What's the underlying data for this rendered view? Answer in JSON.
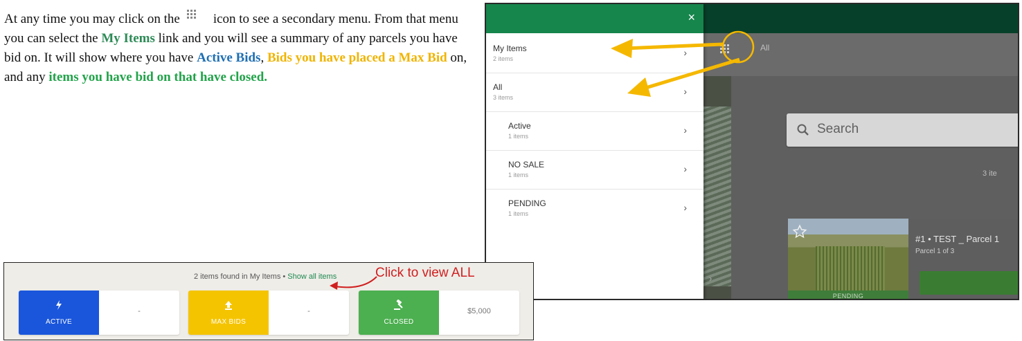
{
  "instruction": {
    "p1": "At any time you may click on the",
    "p2": "icon to see a secondary menu. From that menu you can select the",
    "my_items": "My Items",
    "p3": "link and you will see a summary of any parcels you have bid on. It will show where you have",
    "active_bids": "Active Bids",
    "comma": ",",
    "max_bid": "Bids you have placed a Max Bid",
    "p4": "on, and any",
    "closed": "items you have bid on that have closed."
  },
  "drawer": {
    "close_glyph": "×",
    "items": [
      {
        "label": "My Items",
        "count": "2 items"
      },
      {
        "label": "All",
        "count": "3 items"
      },
      {
        "label": "Active",
        "count": "1 items"
      },
      {
        "label": "NO SALE",
        "count": "1 items"
      },
      {
        "label": "PENDING",
        "count": "1 items"
      }
    ]
  },
  "screen": {
    "breadcrumb": "All",
    "search_placeholder": "Search",
    "count_truncated": "3 ite",
    "card": {
      "title": "#1 • TEST _ Parcel 1",
      "subtitle": "Parcel 1 of 3",
      "status": "PENDING"
    }
  },
  "panel": {
    "found_prefix": "2 items found in My Items •",
    "show_all": "Show all items",
    "click_view": "Click to view ALL",
    "stats": [
      {
        "label": "ACTIVE",
        "value": "-",
        "color": "#1a56db",
        "icon": "lightning-icon"
      },
      {
        "label": "MAX BIDS",
        "value": "-",
        "color": "#f5c400",
        "icon": "upload-arrow-icon"
      },
      {
        "label": "CLOSED",
        "value": "$5,000",
        "color": "#4caf50",
        "icon": "gavel-icon"
      }
    ]
  },
  "colors": {
    "header_dark": "#07402a",
    "drawer_head": "#16864c",
    "arrow_yellow": "#f5b800",
    "annotation_red": "#d01f1f"
  }
}
